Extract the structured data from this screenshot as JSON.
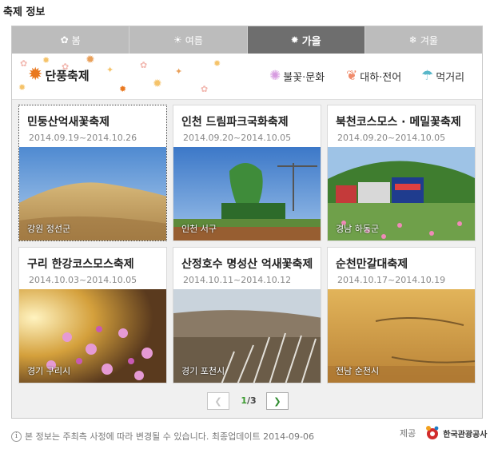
{
  "page_title": "축제 정보",
  "season_tabs": [
    {
      "label": "봄",
      "icon": "flower-icon",
      "active": false
    },
    {
      "label": "여름",
      "icon": "sun-icon",
      "active": false
    },
    {
      "label": "가을",
      "icon": "maple-leaf-icon",
      "active": true
    },
    {
      "label": "겨울",
      "icon": "snowflake-icon",
      "active": false
    }
  ],
  "categories": {
    "main": "단풍축제",
    "sub": [
      "불꽃·문화",
      "대하·전어",
      "먹거리"
    ]
  },
  "festivals": [
    {
      "title": "민둥산억새꽃축제",
      "dates": "2014.09.19~2014.10.26",
      "location": "강원 정선군"
    },
    {
      "title": "인천 드림파크국화축제",
      "dates": "2014.09.20~2014.10.05",
      "location": "인천 서구"
    },
    {
      "title": "북천코스모스 · 메밀꽃축제",
      "dates": "2014.09.20~2014.10.05",
      "location": "경남 하동군"
    },
    {
      "title": "구리 한강코스모스축제",
      "dates": "2014.10.03~2014.10.05",
      "location": "경기 구리시"
    },
    {
      "title": "산정호수 명성산 억새꽃축제",
      "dates": "2014.10.11~2014.10.12",
      "location": "경기 포천시"
    },
    {
      "title": "순천만갈대축제",
      "dates": "2014.10.17~2014.10.19",
      "location": "전남 순천시"
    }
  ],
  "pager": {
    "current": "1",
    "total": "/3"
  },
  "footer": {
    "notice": "본 정보는 주최측 사정에 따라 변경될 수 있습니다.  최종업데이트 2014-09-06",
    "provider_label": "제공",
    "provider_name": "한국관광공사"
  },
  "colors": {
    "active_tab": "#6e6e6e",
    "inactive_tab": "#bcbcbc",
    "pager_accent": "#3a9a2e",
    "maple": "#e9781f"
  }
}
